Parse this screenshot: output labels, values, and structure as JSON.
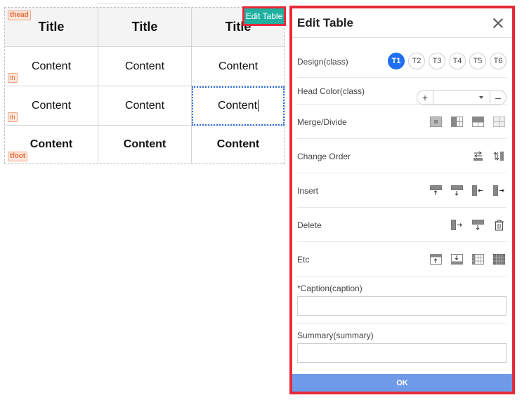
{
  "table": {
    "tags": {
      "thead": "thead",
      "th": "th",
      "tfoot": "tfoot"
    },
    "header": [
      "Title",
      "Title",
      "Title"
    ],
    "rows": [
      [
        "Content",
        "Content",
        "Content"
      ],
      [
        "Content",
        "Content",
        "Content"
      ]
    ],
    "footer": [
      "Content",
      "Content",
      "Content"
    ]
  },
  "edit_button": {
    "label": "Edit Table"
  },
  "dialog": {
    "title": "Edit Table",
    "design": {
      "label": "Design(class)",
      "options": [
        "T1",
        "T2",
        "T3",
        "T4",
        "T5",
        "T6"
      ],
      "selected": "T1"
    },
    "head_color": {
      "label": "Head Color(class)",
      "plus": "+",
      "minus": "–",
      "value": ""
    },
    "merge": {
      "label": "Merge/Divide"
    },
    "order": {
      "label": "Change Order"
    },
    "insert": {
      "label": "Insert"
    },
    "delete": {
      "label": "Delete"
    },
    "etc": {
      "label": "Etc"
    },
    "caption": {
      "label": "*Caption(caption)",
      "value": ""
    },
    "summary": {
      "label": "Summary(summary)",
      "value": ""
    },
    "ok": "OK"
  }
}
